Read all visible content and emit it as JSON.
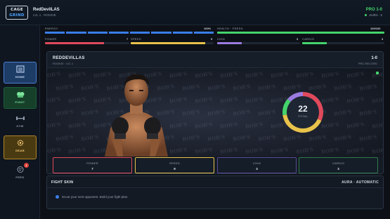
{
  "app": {
    "logo_line1": "CAGE",
    "logo_line2": "GRIND"
  },
  "player": {
    "name": "RedDevilLAS",
    "subtitle": "LVL 1 · ROOKIE",
    "record": "PRO 1-0",
    "aura": "AURA · 2"
  },
  "sidebar": {
    "items": [
      {
        "label": "HOME",
        "icon": "home-icon"
      },
      {
        "label": "FIGHT",
        "icon": "gloves-icon"
      },
      {
        "label": "GYM",
        "icon": "dumbbell-icon"
      },
      {
        "label": "GEAR",
        "icon": "gear-icon"
      },
      {
        "label": "FEED",
        "icon": "feed-icon",
        "badge": "1"
      }
    ]
  },
  "stats_bar": {
    "energy_label": "ENERGY",
    "energy_value": "100%",
    "energy_fraction": 1.0,
    "health_label": "HEALTH · FRESH",
    "health_value": "100/100",
    "health_fraction": 1.0,
    "power_label": "POWER",
    "power_value": "7",
    "speed_label": "SPEED",
    "speed_value": "9",
    "chin_label": "CHIN",
    "chin_value": "3",
    "cardio_label": "CARDIO",
    "cardio_value": "3"
  },
  "fighter": {
    "name": "REDDEVILLAS",
    "subtitle": "ROOKIE · LVL 1",
    "record_value": "1-0",
    "record_label": "PRO RECORD",
    "sponsor_watermark": "BOB'S",
    "total_value": "22",
    "total_label": "TOTAL",
    "stats": [
      {
        "name": "POWER",
        "value": "7",
        "color": "#e04a5c"
      },
      {
        "name": "SPEED",
        "value": "9",
        "color": "#e8c24a"
      },
      {
        "name": "CHIN",
        "value": "3",
        "color": "#9b7be0"
      },
      {
        "name": "CARDIO",
        "value": "3",
        "color": "#45d36b"
      }
    ]
  },
  "fight_skin": {
    "title": "FIGHT SKIN",
    "aura_label": "AURA · AUTOMATIC",
    "tip": "Scout your next opponent. Build your fight plan."
  },
  "colors": {
    "accent_blue": "#3b7ee8",
    "accent_green": "#45d36b",
    "gear_gold": "#b0852a"
  }
}
